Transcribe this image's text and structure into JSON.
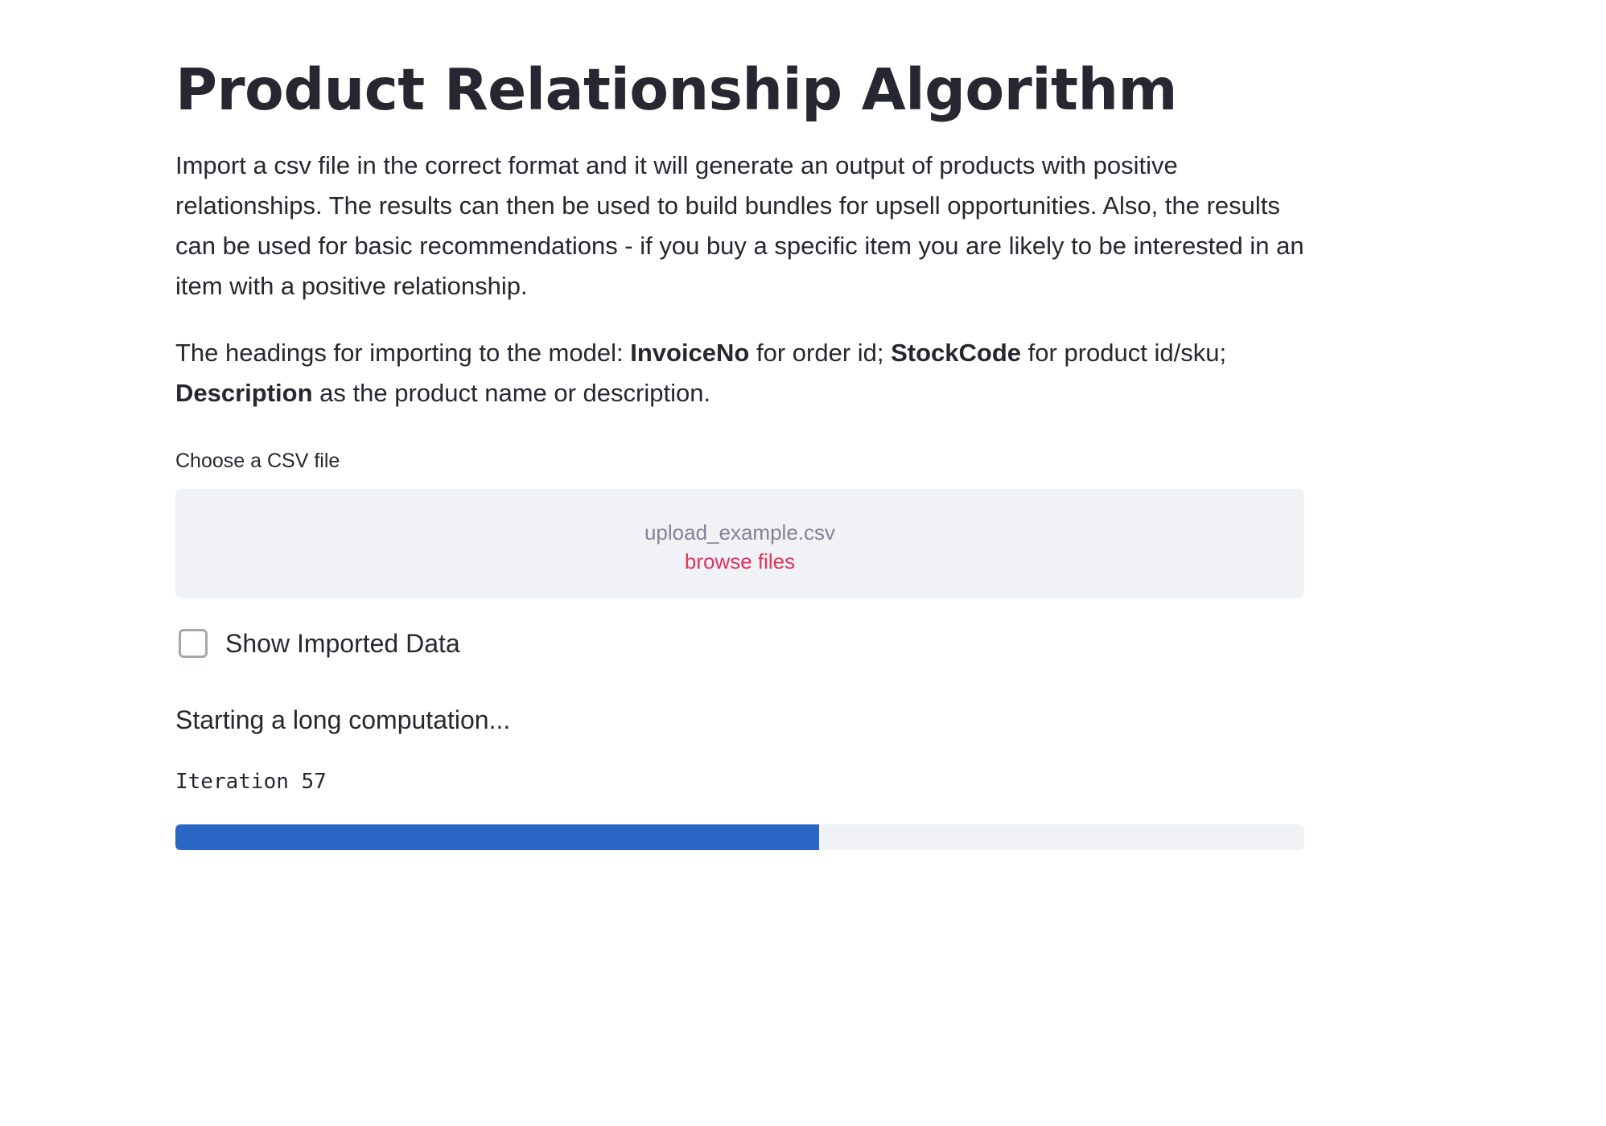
{
  "page": {
    "title": "Product Relationship Algorithm",
    "intro": "Import a csv file in the correct format and it will generate an output of products with positive relationships. The results can then be used to build bundles for upsell opportunities. Also, the results can be used for basic recommendations - if you buy a specific item you are likely to be interested in an item with a positive relationship.",
    "headings": {
      "prefix": "The headings for importing to the model: ",
      "invoice_term": "InvoiceNo",
      "invoice_desc": " for order id; ",
      "stock_term": "StockCode",
      "stock_desc": " for product id/sku; ",
      "description_term": "Description",
      "description_desc": " as the product name or description."
    }
  },
  "uploader": {
    "label": "Choose a CSV file",
    "filename": "upload_example.csv",
    "browse_label": "browse files"
  },
  "checkbox": {
    "label": "Show Imported Data",
    "checked": false
  },
  "status": {
    "text": "Starting a long computation...",
    "iteration_text": "Iteration 57",
    "progress_percent": 57
  },
  "colors": {
    "accent": "#e0345c",
    "progress": "#2a67c5",
    "text": "#262730",
    "muted": "#808495",
    "surface": "#f0f2f6"
  }
}
